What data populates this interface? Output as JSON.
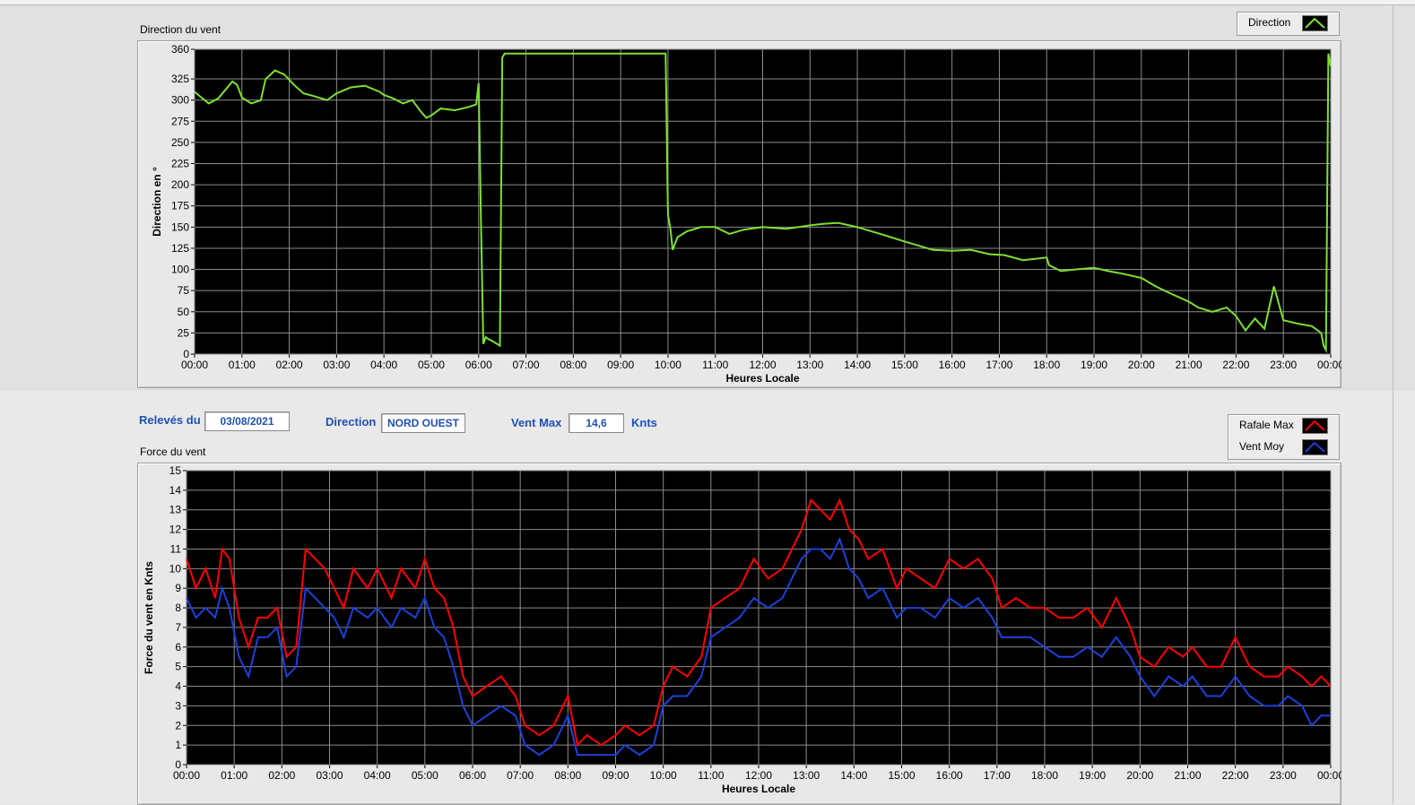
{
  "direction_chart": {
    "title": "Direction du vent",
    "ylabel": "Direction en °",
    "xlabel": "Heures Locale",
    "legend": [
      {
        "name": "Direction",
        "color": "#7de033"
      }
    ]
  },
  "force_chart": {
    "title": "Force du vent",
    "ylabel": "Force du vent en Knts",
    "xlabel": "Heures Locale",
    "legend": [
      {
        "name": "Rafale Max",
        "color": "#ff0000"
      },
      {
        "name": "Vent Moy",
        "color": "#1e40d8"
      }
    ]
  },
  "info": {
    "date_label": "Relevés du",
    "date_value": "03/08/2021",
    "direction_label": "Direction",
    "direction_value": "NORD OUEST",
    "vent_max_label": "Vent Max",
    "vent_max_value": "14,6",
    "unit": "Knts"
  },
  "chart_data": [
    {
      "type": "line",
      "title": "Direction du vent",
      "xlabel": "Heures Locale",
      "ylabel": "Direction en °",
      "xlim": [
        0,
        24
      ],
      "ylim": [
        0,
        360
      ],
      "yticks": [
        0,
        25,
        50,
        75,
        100,
        125,
        150,
        175,
        200,
        225,
        250,
        275,
        300,
        325,
        360
      ],
      "xtick_labels": [
        "00:00",
        "01:00",
        "02:00",
        "03:00",
        "04:00",
        "05:00",
        "06:00",
        "07:00",
        "08:00",
        "09:00",
        "10:00",
        "11:00",
        "12:00",
        "13:00",
        "14:00",
        "15:00",
        "16:00",
        "17:00",
        "18:00",
        "19:00",
        "20:00",
        "21:00",
        "22:00",
        "23:00",
        "00:00"
      ],
      "grid": true,
      "legend_position": "top-right",
      "series": [
        {
          "name": "Direction",
          "color": "#7de033",
          "x": [
            0,
            0.1,
            0.3,
            0.5,
            0.8,
            0.9,
            1.0,
            1.2,
            1.4,
            1.5,
            1.7,
            1.9,
            2.1,
            2.3,
            2.5,
            2.8,
            3.0,
            3.3,
            3.6,
            3.9,
            4.0,
            4.2,
            4.4,
            4.6,
            4.8,
            4.9,
            5.0,
            5.2,
            5.5,
            5.8,
            5.95,
            6.0,
            6.05,
            6.1,
            6.15,
            6.2,
            6.3,
            6.45,
            6.5,
            6.55,
            7.0,
            8.0,
            9.0,
            9.9,
            9.95,
            10.0,
            10.05,
            10.1,
            10.2,
            10.4,
            10.7,
            11.0,
            11.3,
            11.6,
            12.0,
            12.5,
            13.0,
            13.3,
            13.6,
            14.0,
            14.3,
            14.6,
            15.0,
            15.3,
            15.6,
            16.0,
            16.4,
            16.8,
            17.1,
            17.5,
            18.0,
            18.05,
            18.3,
            18.6,
            19.0,
            19.3,
            19.6,
            20.0,
            20.3,
            20.6,
            21.0,
            21.2,
            21.5,
            21.8,
            22.0,
            22.2,
            22.4,
            22.6,
            22.8,
            23.0,
            23.3,
            23.6,
            23.8,
            23.85,
            23.9,
            23.95,
            24.0
          ],
          "y": [
            310,
            305,
            296,
            302,
            322,
            318,
            303,
            296,
            300,
            325,
            335,
            330,
            318,
            308,
            305,
            300,
            308,
            315,
            317,
            310,
            306,
            302,
            296,
            300,
            285,
            279,
            282,
            290,
            288,
            292,
            295,
            320,
            155,
            12,
            20,
            18,
            15,
            10,
            350,
            355,
            355,
            355,
            355,
            355,
            355,
            165,
            148,
            123,
            138,
            145,
            150,
            150,
            142,
            147,
            150,
            148,
            152,
            154,
            155,
            150,
            145,
            140,
            133,
            128,
            123,
            122,
            123,
            118,
            117,
            111,
            114,
            105,
            98,
            100,
            102,
            98,
            95,
            90,
            80,
            72,
            62,
            55,
            50,
            55,
            45,
            28,
            42,
            30,
            80,
            40,
            36,
            33,
            25,
            10,
            5,
            355,
            340
          ]
        }
      ]
    },
    {
      "type": "line",
      "title": "Force du vent",
      "xlabel": "Heures Locale",
      "ylabel": "Force du vent en Knts",
      "xlim": [
        0,
        24
      ],
      "ylim": [
        0,
        15
      ],
      "yticks": [
        0,
        1,
        2,
        3,
        4,
        5,
        6,
        7,
        8,
        9,
        10,
        11,
        12,
        13,
        14,
        15
      ],
      "xtick_labels": [
        "00:00",
        "01:00",
        "02:00",
        "03:00",
        "04:00",
        "05:00",
        "06:00",
        "07:00",
        "08:00",
        "09:00",
        "10:00",
        "11:00",
        "12:00",
        "13:00",
        "14:00",
        "15:00",
        "16:00",
        "17:00",
        "18:00",
        "19:00",
        "20:00",
        "21:00",
        "22:00",
        "23:00",
        "00:00"
      ],
      "grid": true,
      "legend_position": "top-right",
      "series": [
        {
          "name": "Rafale Max",
          "color": "#ff0000",
          "x": [
            0,
            0.2,
            0.4,
            0.6,
            0.75,
            0.9,
            1.1,
            1.3,
            1.5,
            1.7,
            1.9,
            2.1,
            2.3,
            2.5,
            2.7,
            2.9,
            3.1,
            3.3,
            3.5,
            3.8,
            4.0,
            4.3,
            4.5,
            4.8,
            5.0,
            5.2,
            5.4,
            5.6,
            5.8,
            6.0,
            6.3,
            6.6,
            6.9,
            7.1,
            7.4,
            7.7,
            8.0,
            8.2,
            8.4,
            8.7,
            9.0,
            9.2,
            9.5,
            9.8,
            10.0,
            10.2,
            10.5,
            10.8,
            11.0,
            11.3,
            11.6,
            11.9,
            12.2,
            12.5,
            12.7,
            12.9,
            13.1,
            13.3,
            13.5,
            13.7,
            13.9,
            14.1,
            14.3,
            14.6,
            14.9,
            15.1,
            15.4,
            15.7,
            16.0,
            16.3,
            16.6,
            16.9,
            17.1,
            17.4,
            17.7,
            18.0,
            18.3,
            18.6,
            18.9,
            19.2,
            19.5,
            19.8,
            20.0,
            20.3,
            20.6,
            20.9,
            21.1,
            21.4,
            21.7,
            22.0,
            22.3,
            22.6,
            22.9,
            23.1,
            23.4,
            23.6,
            23.8,
            24.0
          ],
          "y": [
            10.5,
            9.0,
            10.0,
            8.5,
            11.0,
            10.5,
            7.5,
            6.0,
            7.5,
            7.5,
            8.0,
            5.5,
            6.0,
            11.0,
            10.5,
            10.0,
            9.0,
            8.0,
            10.0,
            9.0,
            10.0,
            8.5,
            10.0,
            9.0,
            10.5,
            9.0,
            8.5,
            7.0,
            4.5,
            3.5,
            4.0,
            4.5,
            3.5,
            2.0,
            1.5,
            2.0,
            3.5,
            1.0,
            1.5,
            1.0,
            1.5,
            2.0,
            1.5,
            2.0,
            4.0,
            5.0,
            4.5,
            5.5,
            8.0,
            8.5,
            9.0,
            10.5,
            9.5,
            10.0,
            11.0,
            12.0,
            13.5,
            13.0,
            12.5,
            13.5,
            12.0,
            11.5,
            10.5,
            11.0,
            9.0,
            10.0,
            9.5,
            9.0,
            10.5,
            10.0,
            10.5,
            9.5,
            8.0,
            8.5,
            8.0,
            8.0,
            7.5,
            7.5,
            8.0,
            7.0,
            8.5,
            7.0,
            5.5,
            5.0,
            6.0,
            5.5,
            6.0,
            5.0,
            5.0,
            6.5,
            5.0,
            4.5,
            4.5,
            5.0,
            4.5,
            4.0,
            4.5,
            4.0
          ]
        },
        {
          "name": "Vent Moy",
          "color": "#1e40d8",
          "x": [
            0,
            0.2,
            0.4,
            0.6,
            0.75,
            0.9,
            1.1,
            1.3,
            1.5,
            1.7,
            1.9,
            2.1,
            2.3,
            2.5,
            2.7,
            2.9,
            3.1,
            3.3,
            3.5,
            3.8,
            4.0,
            4.3,
            4.5,
            4.8,
            5.0,
            5.2,
            5.4,
            5.6,
            5.8,
            6.0,
            6.3,
            6.6,
            6.9,
            7.1,
            7.4,
            7.7,
            8.0,
            8.2,
            8.4,
            8.7,
            9.0,
            9.2,
            9.5,
            9.8,
            10.0,
            10.2,
            10.5,
            10.8,
            11.0,
            11.3,
            11.6,
            11.9,
            12.2,
            12.5,
            12.7,
            12.9,
            13.1,
            13.3,
            13.5,
            13.7,
            13.9,
            14.1,
            14.3,
            14.6,
            14.9,
            15.1,
            15.4,
            15.7,
            16.0,
            16.3,
            16.6,
            16.9,
            17.1,
            17.4,
            17.7,
            18.0,
            18.3,
            18.6,
            18.9,
            19.2,
            19.5,
            19.8,
            20.0,
            20.3,
            20.6,
            20.9,
            21.1,
            21.4,
            21.7,
            22.0,
            22.3,
            22.6,
            22.9,
            23.1,
            23.4,
            23.6,
            23.8,
            24.0
          ],
          "y": [
            8.5,
            7.5,
            8.0,
            7.5,
            9.0,
            8.0,
            5.5,
            4.5,
            6.5,
            6.5,
            7.0,
            4.5,
            5.0,
            9.0,
            8.5,
            8.0,
            7.5,
            6.5,
            8.0,
            7.5,
            8.0,
            7.0,
            8.0,
            7.5,
            8.5,
            7.0,
            6.5,
            5.0,
            3.0,
            2.0,
            2.5,
            3.0,
            2.5,
            1.0,
            0.5,
            1.0,
            2.5,
            0.5,
            0.5,
            0.5,
            0.5,
            1.0,
            0.5,
            1.0,
            3.0,
            3.5,
            3.5,
            4.5,
            6.5,
            7.0,
            7.5,
            8.5,
            8.0,
            8.5,
            9.5,
            10.5,
            11.0,
            11.0,
            10.5,
            11.5,
            10.0,
            9.5,
            8.5,
            9.0,
            7.5,
            8.0,
            8.0,
            7.5,
            8.5,
            8.0,
            8.5,
            7.5,
            6.5,
            6.5,
            6.5,
            6.0,
            5.5,
            5.5,
            6.0,
            5.5,
            6.5,
            5.5,
            4.5,
            3.5,
            4.5,
            4.0,
            4.5,
            3.5,
            3.5,
            4.5,
            3.5,
            3.0,
            3.0,
            3.5,
            3.0,
            2.0,
            2.5,
            2.5
          ]
        }
      ]
    }
  ]
}
